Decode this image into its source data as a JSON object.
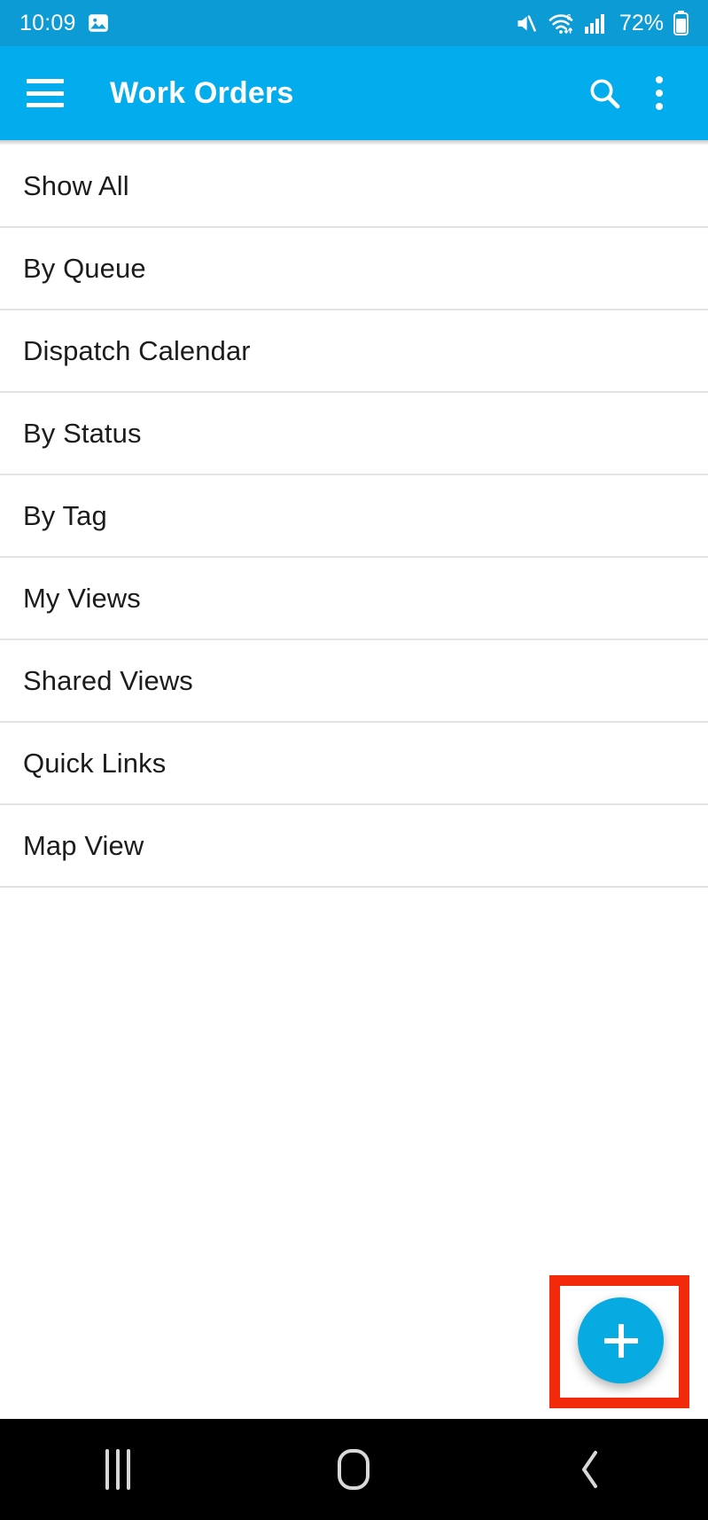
{
  "status_bar": {
    "time": "10:09",
    "battery_percent": "72%",
    "icons": [
      "image-thumbnail-icon",
      "volume-mute-icon",
      "wifi-6-icon",
      "cellular-signal-icon",
      "battery-icon"
    ],
    "background_color": "#0d9bd6"
  },
  "app_bar": {
    "title": "Work Orders",
    "menu_icon": "hamburger-menu-icon",
    "search_icon": "search-icon",
    "overflow_icon": "overflow-menu-icon",
    "background_color": "#03acec"
  },
  "list": {
    "items": [
      {
        "label": "Show All"
      },
      {
        "label": "By Queue"
      },
      {
        "label": "Dispatch Calendar"
      },
      {
        "label": "By Status"
      },
      {
        "label": "By Tag"
      },
      {
        "label": "My Views"
      },
      {
        "label": "Shared Views"
      },
      {
        "label": "Quick Links"
      },
      {
        "label": "Map View"
      }
    ]
  },
  "fab": {
    "icon": "plus-icon",
    "color": "#07abe2",
    "highlight_color": "#f3290b"
  },
  "nav_bar": {
    "recents": "recents-icon",
    "home": "home-icon",
    "back": "back-icon",
    "background_color": "#000000"
  }
}
